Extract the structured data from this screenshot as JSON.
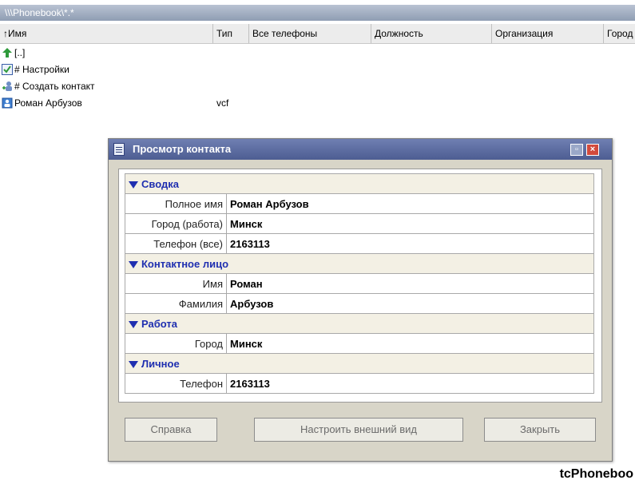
{
  "path": "\\\\\\Phonebook\\*.*",
  "columns": [
    "↑Имя",
    "Тип",
    "Все телефоны",
    "Должность",
    "Организация",
    "Город"
  ],
  "rows": [
    {
      "icon": "up-arrow-icon",
      "name": "[..]",
      "type": ""
    },
    {
      "icon": "checkbox-checked-icon",
      "name": "# Настройки",
      "type": ""
    },
    {
      "icon": "new-contact-icon",
      "name": "# Создать контакт",
      "type": ""
    },
    {
      "icon": "contact-card-icon",
      "name": "Роман Арбузов",
      "type": "vcf"
    }
  ],
  "dialog": {
    "title": "Просмотр контакта",
    "sections": [
      {
        "title": "Сводка",
        "fields": [
          {
            "label": "Полное имя",
            "value": "Роман Арбузов"
          },
          {
            "label": "Город (работа)",
            "value": "Минск"
          },
          {
            "label": "Телефон (все)",
            "value": "2163113"
          }
        ]
      },
      {
        "title": "Контактное лицо",
        "fields": [
          {
            "label": "Имя",
            "value": "Роман"
          },
          {
            "label": "Фамилия",
            "value": "Арбузов"
          }
        ]
      },
      {
        "title": "Работа",
        "fields": [
          {
            "label": "Город",
            "value": "Минск"
          }
        ]
      },
      {
        "title": "Личное",
        "fields": [
          {
            "label": "Телефон",
            "value": "2163113"
          }
        ]
      }
    ],
    "buttons": {
      "help": "Справка",
      "customize": "Настроить внешний вид",
      "close": "Закрыть"
    }
  },
  "footer": "tcPhoneboo",
  "colors": {
    "section_text": "#1f2fb0",
    "title_bar": "#5a6aa0"
  }
}
